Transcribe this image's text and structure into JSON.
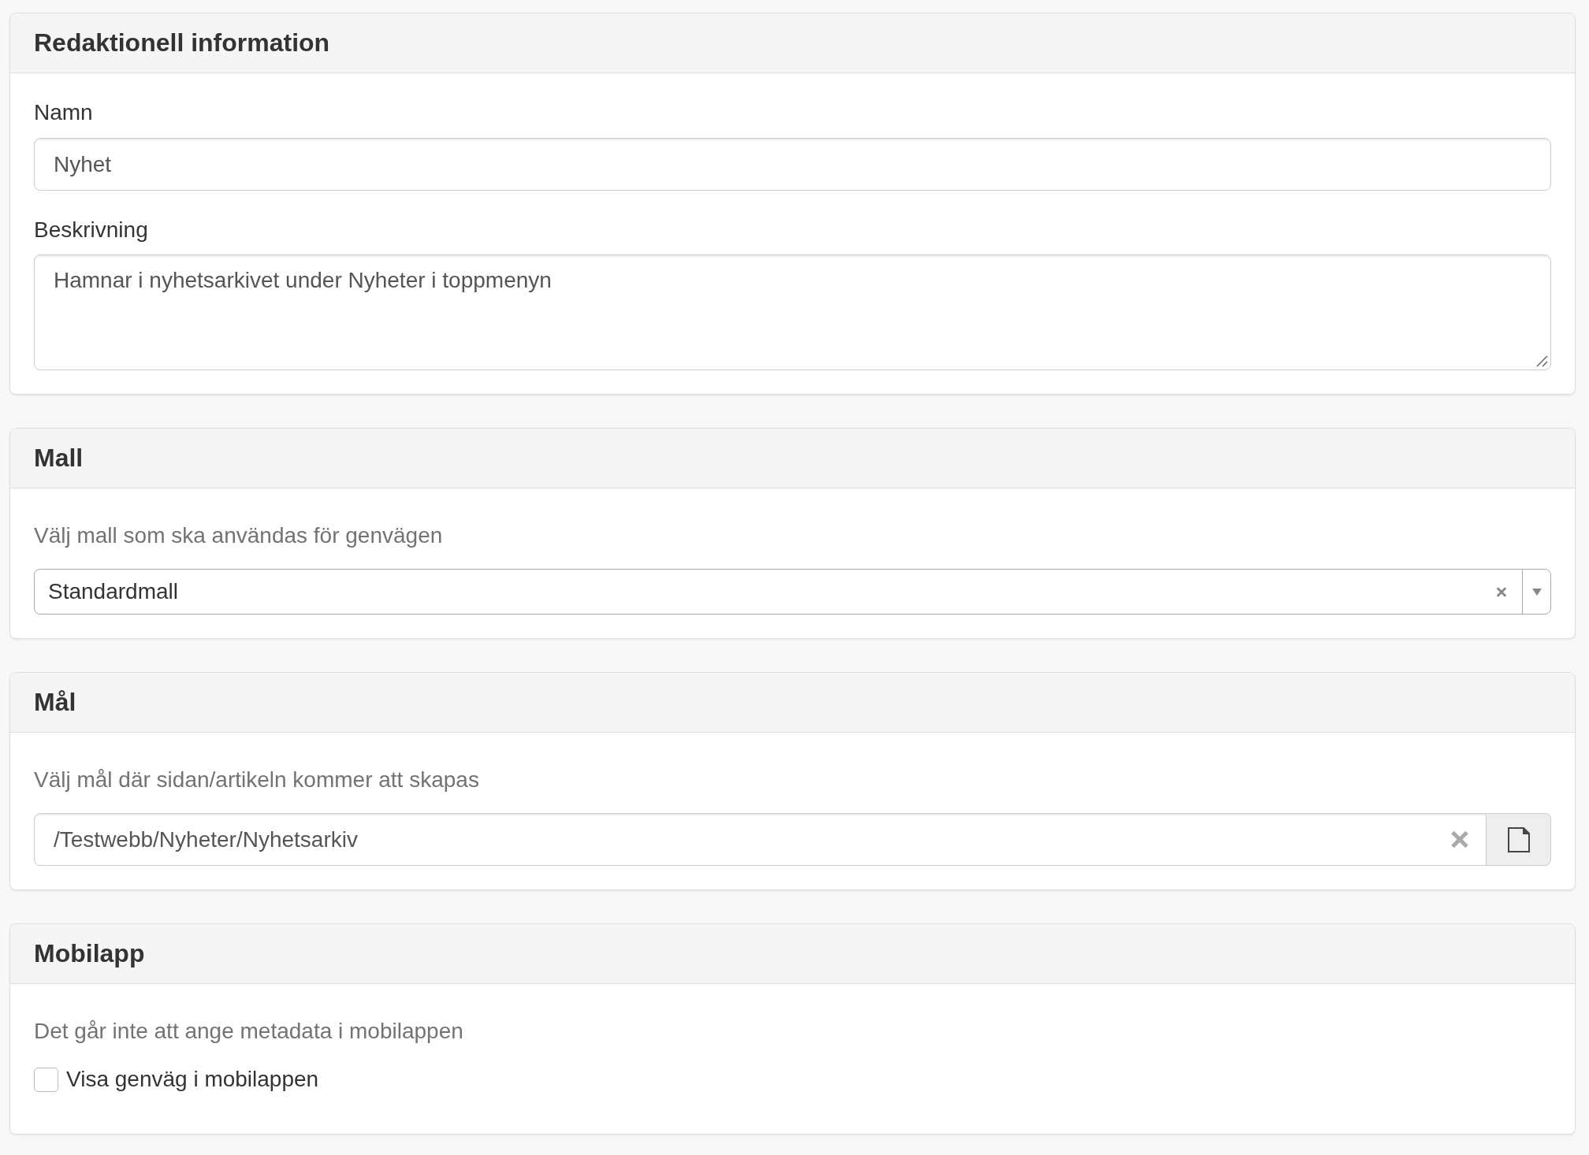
{
  "editorial_panel": {
    "title": "Redaktionell information",
    "name_field": {
      "label": "Namn",
      "value": "Nyhet"
    },
    "description_field": {
      "label": "Beskrivning",
      "value": "Hamnar i nyhetsarkivet under Nyheter i toppmenyn"
    }
  },
  "template_panel": {
    "title": "Mall",
    "help": "Välj mall som ska användas för genvägen",
    "select": {
      "value": "Standardmall"
    }
  },
  "target_panel": {
    "title": "Mål",
    "help": "Välj mål där sidan/artikeln kommer att skapas",
    "field": {
      "value": "/Testwebb/Nyheter/Nyhetsarkiv"
    }
  },
  "mobile_panel": {
    "title": "Mobilapp",
    "help": "Det går inte att ange metadata i mobilappen",
    "checkbox": {
      "label": "Visa genväg i mobilappen",
      "checked": false
    }
  }
}
